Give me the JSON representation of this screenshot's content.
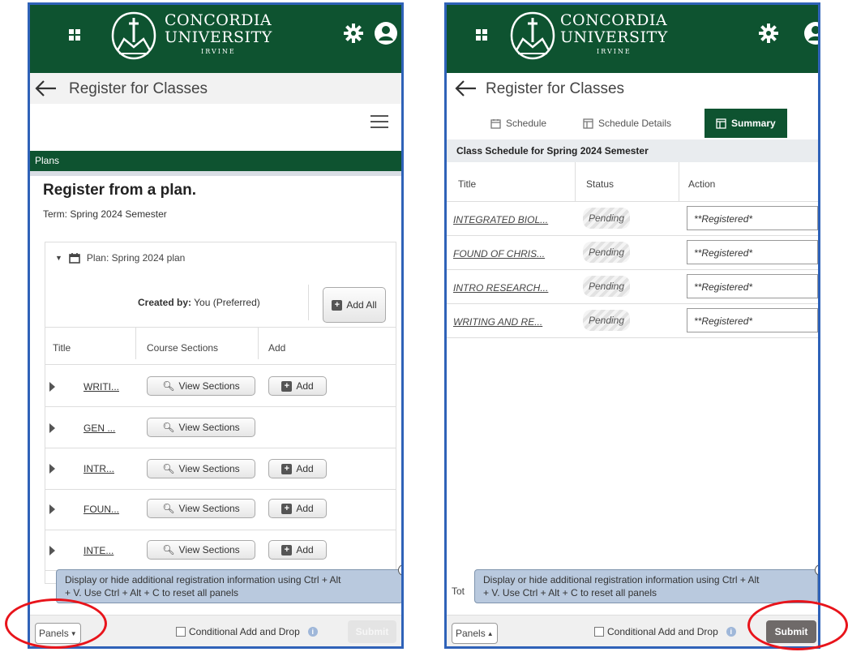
{
  "brand": {
    "line1": "CONCORDIA",
    "line2": "UNIVERSITY",
    "line3": "IRVINE"
  },
  "page": {
    "title": "Register for Classes"
  },
  "left": {
    "plans_label": "Plans",
    "heading": "Register from a plan.",
    "term": "Term: Spring 2024 Semester",
    "plan_name": "Plan: Spring 2024 plan",
    "created_label": "Created by:",
    "created_value": "You (Preferred)",
    "add_all": "Add All",
    "columns": {
      "title": "Title",
      "sections": "Course Sections",
      "add": "Add"
    },
    "view_sections": "View Sections",
    "add_label": "Add",
    "rows": [
      {
        "title": "WRITI...",
        "has_add": true
      },
      {
        "title": "GEN ...",
        "has_add": false
      },
      {
        "title": "INTR...",
        "has_add": true
      },
      {
        "title": "FOUN...",
        "has_add": true
      },
      {
        "title": "INTE...",
        "has_add": true
      }
    ]
  },
  "right": {
    "tabs": {
      "schedule": "Schedule",
      "details": "Schedule Details",
      "summary": "Summary"
    },
    "schedule_header": "Class Schedule for Spring 2024 Semester",
    "columns": {
      "title": "Title",
      "status": "Status",
      "action": "Action"
    },
    "rows": [
      {
        "title": "INTEGRATED BIOL...",
        "status": "Pending",
        "action": "**Registered*"
      },
      {
        "title": "FOUND OF CHRIS...",
        "status": "Pending",
        "action": "**Registered*"
      },
      {
        "title": "INTRO RESEARCH...",
        "status": "Pending",
        "action": "**Registered*"
      },
      {
        "title": "WRITING AND RE...",
        "status": "Pending",
        "action": "**Registered*"
      }
    ],
    "tot_fragment": "Tot"
  },
  "tooltip": {
    "line1": "Display or hide additional registration information using Ctrl + Alt",
    "line2": "+ V. Use Ctrl + Alt + C to reset all panels"
  },
  "bottom": {
    "panels": "Panels",
    "conditional": "Conditional Add and Drop",
    "submit": "Submit"
  },
  "colors": {
    "brand_green": "#0e5330",
    "highlight_red": "#e8141b",
    "frame_blue": "#2f62b8"
  }
}
